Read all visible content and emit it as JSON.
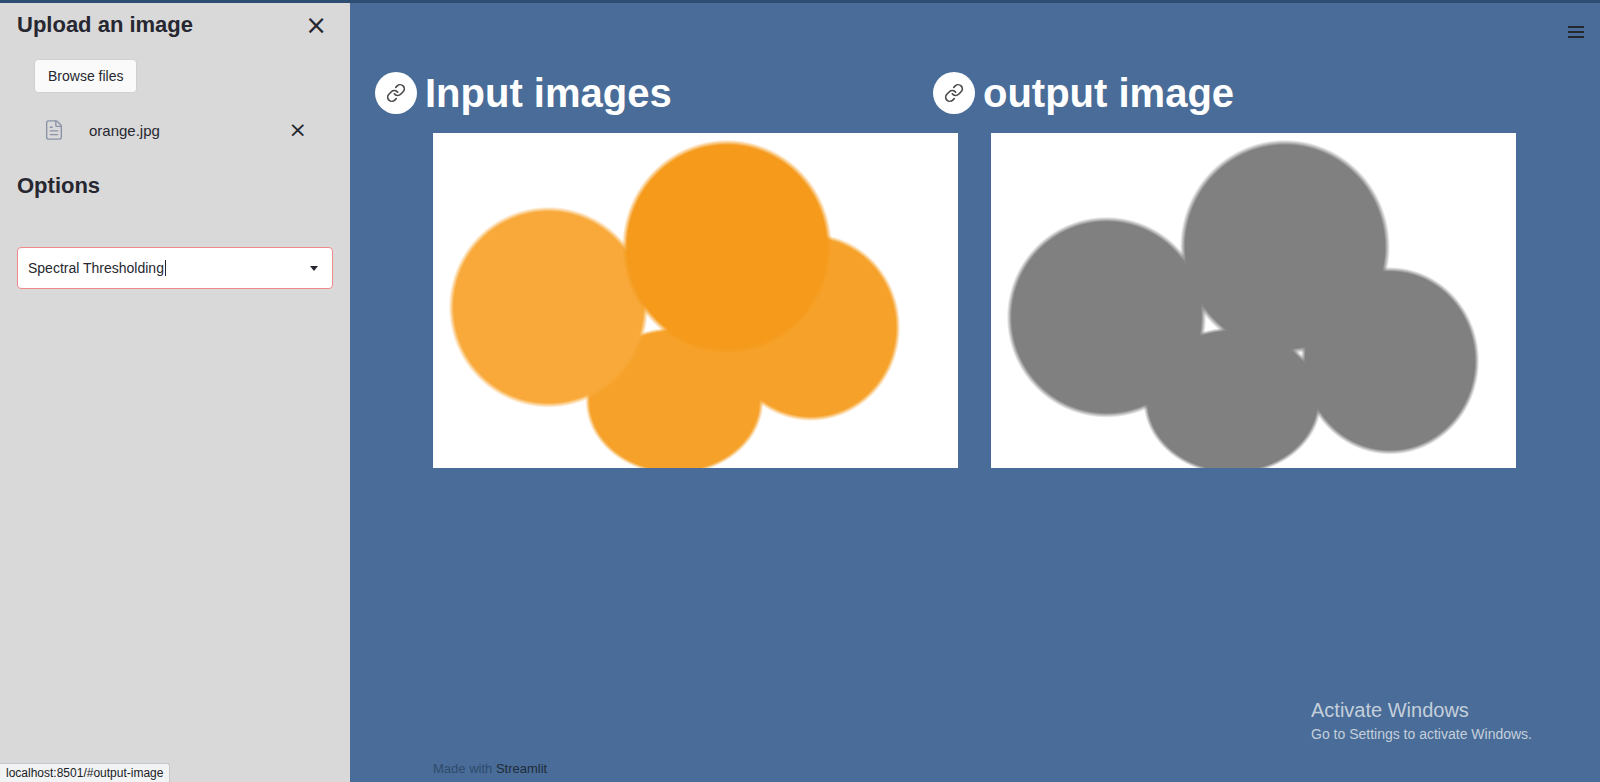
{
  "sidebar": {
    "title": "Upload an image",
    "close": "×",
    "upload_button": "Browse files",
    "files": [
      {
        "name": "orange.jpg",
        "remove": "×"
      }
    ],
    "options_title": "Options",
    "select": {
      "value": "Spectral Thresholding",
      "focused": true
    }
  },
  "main": {
    "columns": [
      {
        "title": "Input images",
        "image": "input"
      },
      {
        "title": "output image",
        "image": "output"
      }
    ],
    "footer": {
      "prefix": "Made with ",
      "brand": "Streamlit"
    }
  },
  "watermark": {
    "title": "Activate Windows",
    "subtitle": "Go to Settings to activate Windows."
  },
  "status_bar": "localhost:8501/#output-image"
}
